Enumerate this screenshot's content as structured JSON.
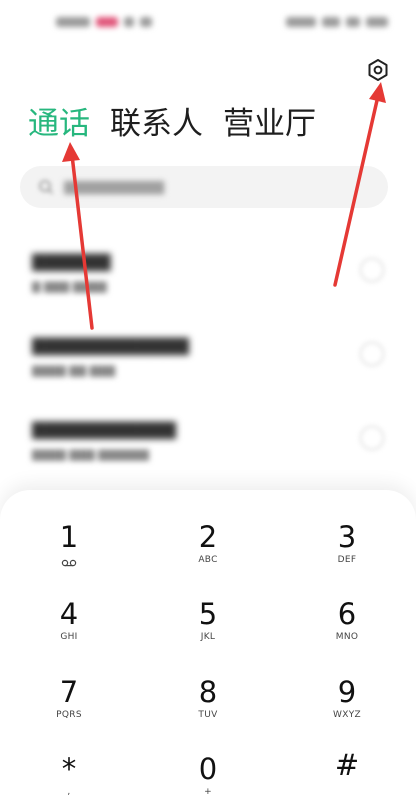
{
  "tabs": [
    {
      "label": "通话",
      "active": true
    },
    {
      "label": "联系人",
      "active": false
    },
    {
      "label": "营业厅",
      "active": false
    }
  ],
  "colors": {
    "accent": "#27b77e",
    "arrow": "#e53935"
  },
  "icons": {
    "settings": "hexagon-gear-icon",
    "search": "search-icon",
    "voicemail": "voicemail-icon",
    "info": "info-icon"
  },
  "dialpad": {
    "keys": [
      {
        "num": "1",
        "sub": ""
      },
      {
        "num": "2",
        "sub": "ABC"
      },
      {
        "num": "3",
        "sub": "DEF"
      },
      {
        "num": "4",
        "sub": "GHI"
      },
      {
        "num": "5",
        "sub": "JKL"
      },
      {
        "num": "6",
        "sub": "MNO"
      },
      {
        "num": "7",
        "sub": "PQRS"
      },
      {
        "num": "8",
        "sub": "TUV"
      },
      {
        "num": "9",
        "sub": "WXYZ"
      },
      {
        "num": "*",
        "sub": ","
      },
      {
        "num": "0",
        "sub": "+"
      },
      {
        "num": "#",
        "sub": ""
      }
    ]
  }
}
